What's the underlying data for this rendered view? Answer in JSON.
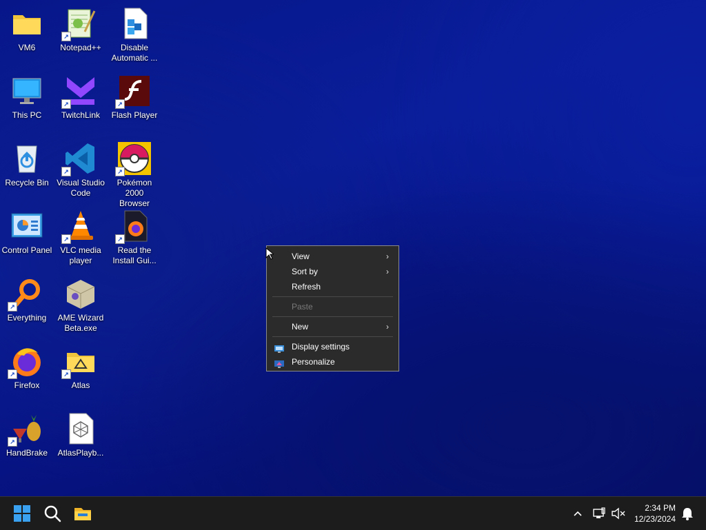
{
  "desktop": {
    "icons": [
      {
        "label": "VM6"
      },
      {
        "label": "Notepad++"
      },
      {
        "label": "Disable\nAutomatic ..."
      },
      {
        "label": "This PC"
      },
      {
        "label": "TwitchLink"
      },
      {
        "label": "Flash Player"
      },
      {
        "label": "Recycle Bin"
      },
      {
        "label": "Visual Studio\nCode"
      },
      {
        "label": "Pokémon\n2000 Browser"
      },
      {
        "label": "Control Panel"
      },
      {
        "label": "VLC media\nplayer"
      },
      {
        "label": "Read the\nInstall Gui..."
      },
      {
        "label": "Everything"
      },
      {
        "label": "AME Wizard\nBeta.exe"
      },
      {
        "label": "Firefox"
      },
      {
        "label": "Atlas"
      },
      {
        "label": "HandBrake"
      },
      {
        "label": "AtlasPlayb..."
      }
    ]
  },
  "context_menu": {
    "view": "View",
    "sort_by": "Sort by",
    "refresh": "Refresh",
    "paste": "Paste",
    "new": "New",
    "display_settings": "Display settings",
    "personalize": "Personalize",
    "arrow": "›"
  },
  "taskbar": {
    "time": "2:34 PM",
    "date": "12/23/2024",
    "chevron": "^"
  },
  "colors": {
    "accent": "#0078d4",
    "menu_bg": "#2b2b2b",
    "taskbar_bg": "#1c1c1c"
  }
}
